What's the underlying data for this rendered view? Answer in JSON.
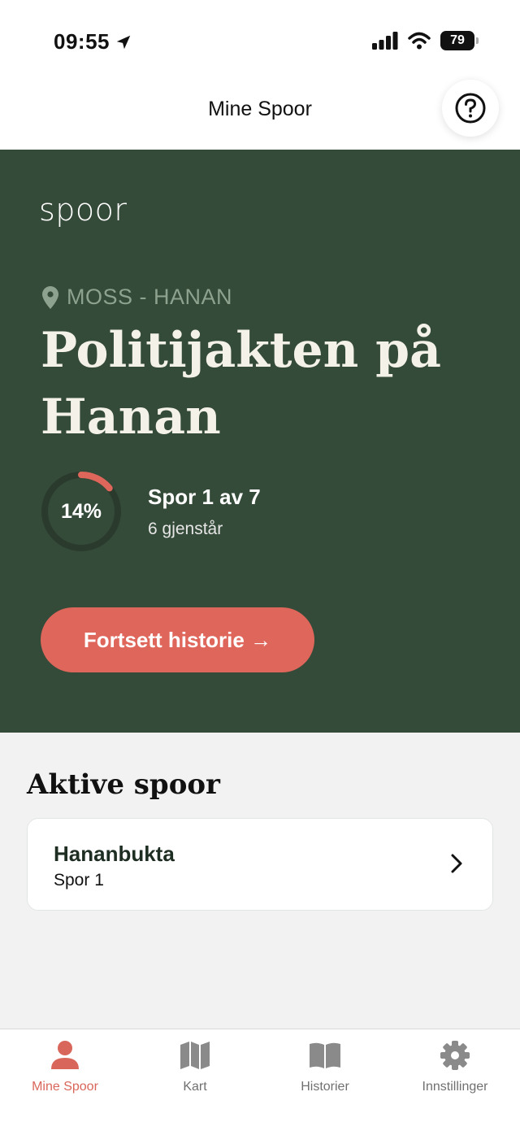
{
  "status": {
    "time": "09:55",
    "battery": "79"
  },
  "header": {
    "title": "Mine Spoor"
  },
  "hero": {
    "brand": "spoor",
    "location": "MOSS - HANAN",
    "title": "Politijakten på Hanan",
    "progress_percent": 14,
    "progress_label": "14%",
    "progress_text": "Spor 1 av 7",
    "remaining_text": "6 gjenstår",
    "continue_label": "Fortsett historie →"
  },
  "active": {
    "title": "Aktive spoor",
    "items": [
      {
        "title": "Hananbukta",
        "subtitle": "Spor 1"
      }
    ]
  },
  "tabs": [
    {
      "label": "Mine Spoor",
      "icon": "person-icon",
      "active": true
    },
    {
      "label": "Kart",
      "icon": "map-icon",
      "active": false
    },
    {
      "label": "Historier",
      "icon": "book-icon",
      "active": false
    },
    {
      "label": "Innstillinger",
      "icon": "gear-icon",
      "active": false
    }
  ],
  "colors": {
    "accent": "#df665a",
    "hero_bg": "#354b39",
    "tab_active": "#d9665b"
  }
}
